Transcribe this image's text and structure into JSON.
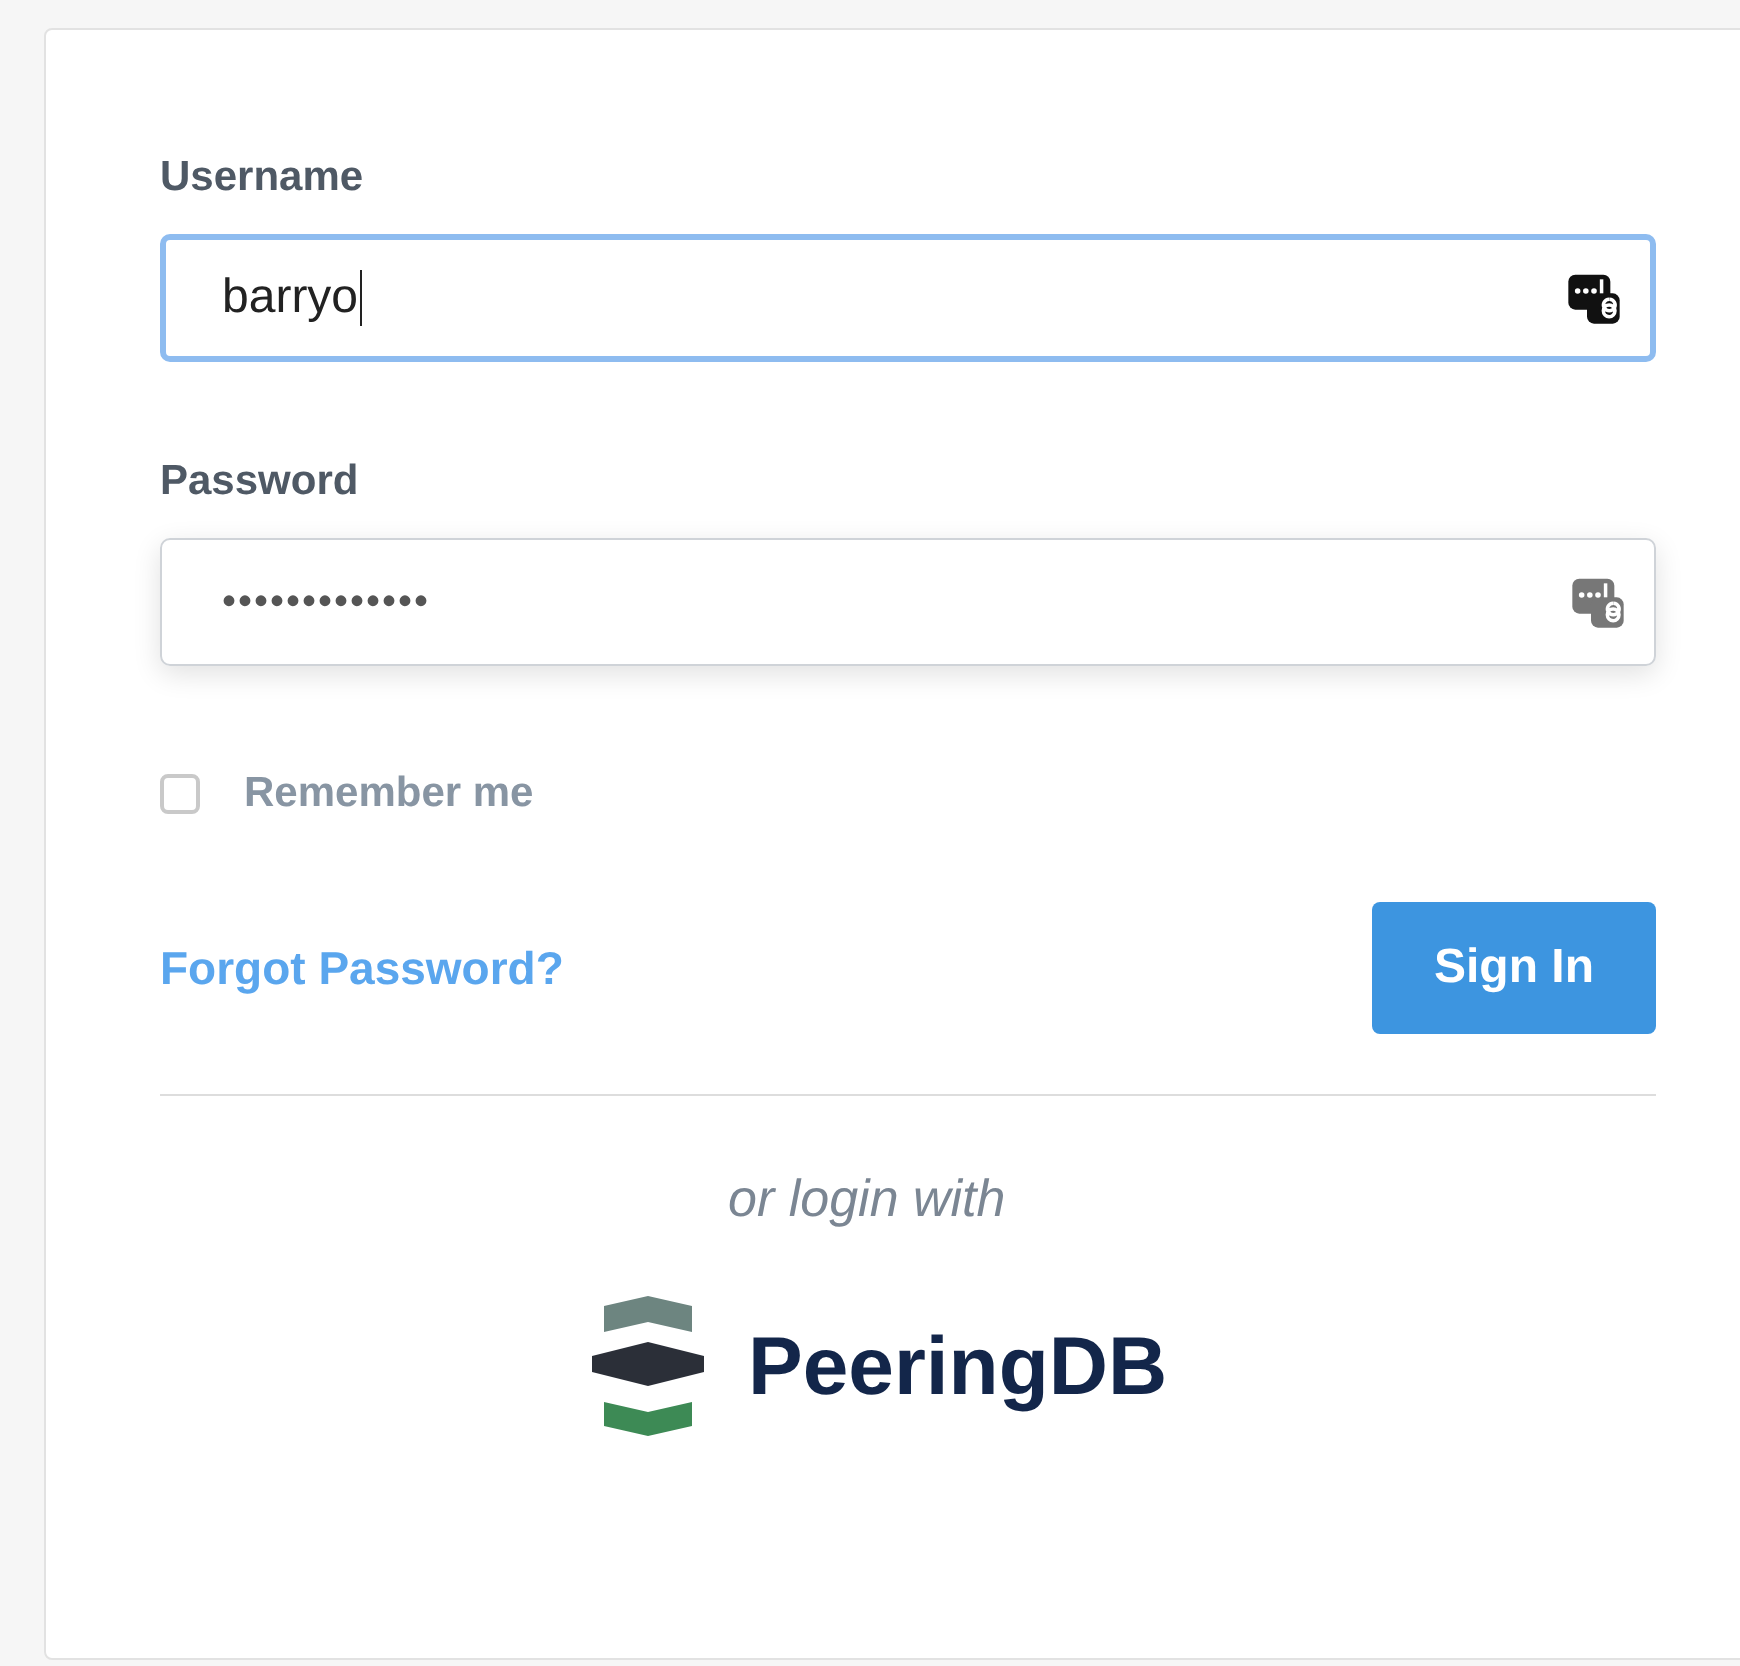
{
  "username": {
    "label": "Username",
    "value": "barryo",
    "focused": true
  },
  "password": {
    "label": "Password",
    "value": "•••••••••••••",
    "focused": false
  },
  "remember": {
    "label": "Remember me",
    "checked": false
  },
  "forgot_link": "Forgot Password?",
  "sign_in_button": "Sign In",
  "alt_login": "or login with",
  "provider": {
    "name": "PeeringDB"
  }
}
